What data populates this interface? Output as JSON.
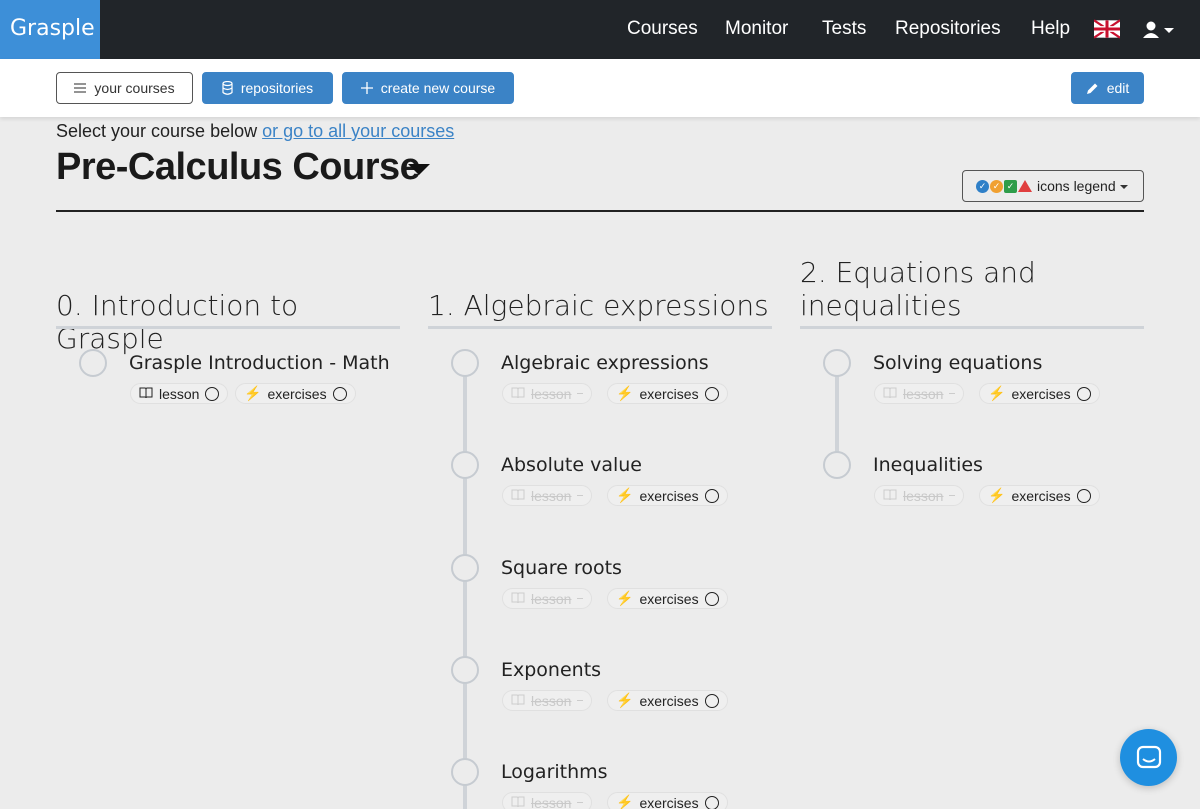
{
  "brand": "Grasple",
  "nav": {
    "items": [
      "Courses",
      "Monitor",
      "Tests",
      "Repositories",
      "Help"
    ]
  },
  "toolbar": {
    "your_courses": "your courses",
    "repositories": "repositories",
    "create_new_course": "create new course",
    "edit": "edit"
  },
  "header": {
    "select_prefix": "Select your course below",
    "select_link": "or go to all your courses",
    "course_title": "Pre-Calculus Course",
    "legend_label": "icons legend"
  },
  "colors": {
    "brand": "#3d8fd8",
    "navbar": "#212529",
    "primary_button": "#3b83c6",
    "legend_blue": "#2f80c8",
    "legend_orange": "#f0a030",
    "legend_green": "#2e9d4a",
    "legend_red": "#e03e3e",
    "chat_button": "#1f8fe0"
  },
  "chapters": [
    {
      "title": "0. Introduction to Grasple",
      "lessons": [
        {
          "title": "Grasple Introduction - Math",
          "lesson_label": "lesson",
          "lesson_enabled": true,
          "exercises_label": "exercises"
        }
      ]
    },
    {
      "title": "1. Algebraic expressions",
      "lessons": [
        {
          "title": "Algebraic expressions",
          "lesson_label": "lesson",
          "lesson_enabled": false,
          "exercises_label": "exercises"
        },
        {
          "title": "Absolute value",
          "lesson_label": "lesson",
          "lesson_enabled": false,
          "exercises_label": "exercises"
        },
        {
          "title": "Square roots",
          "lesson_label": "lesson",
          "lesson_enabled": false,
          "exercises_label": "exercises"
        },
        {
          "title": "Exponents",
          "lesson_label": "lesson",
          "lesson_enabled": false,
          "exercises_label": "exercises"
        },
        {
          "title": "Logarithms",
          "lesson_label": "lesson",
          "lesson_enabled": false,
          "exercises_label": "exercises"
        }
      ]
    },
    {
      "title": "2. Equations and inequalities",
      "lessons": [
        {
          "title": "Solving equations",
          "lesson_label": "lesson",
          "lesson_enabled": false,
          "exercises_label": "exercises"
        },
        {
          "title": "Inequalities",
          "lesson_label": "lesson",
          "lesson_enabled": false,
          "exercises_label": "exercises"
        }
      ]
    }
  ],
  "icons": {
    "your_courses": "list-icon",
    "repositories": "database-icon",
    "create_new_course": "plus-icon",
    "edit": "pencil-icon",
    "lesson": "book-icon",
    "exercises": "lightning-icon",
    "language": "uk-flag-icon",
    "user": "user-icon",
    "chat": "chat-icon"
  }
}
